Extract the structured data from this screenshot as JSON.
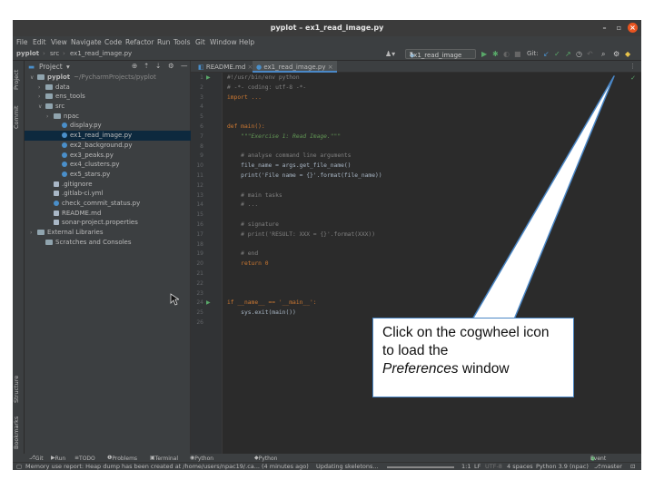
{
  "window": {
    "title": "pyplot – ex1_read_image.py"
  },
  "menu": [
    "File",
    "Edit",
    "View",
    "Navigate",
    "Code",
    "Refactor",
    "Run",
    "Tools",
    "Git",
    "Window",
    "Help"
  ],
  "breadcrumb": {
    "project": "pyplot",
    "sep1": "›",
    "folder": "src",
    "sep2": "›",
    "file": "ex1_read_image.py"
  },
  "run_config": "ex1_read_image",
  "git_label": "Git:",
  "side_left": {
    "project": "Project",
    "commit": "Commit",
    "structure": "Structure",
    "bookmarks": "Bookmarks"
  },
  "project_panel": {
    "title": "Project"
  },
  "tree": [
    {
      "arrow": "∨",
      "label": "pyplot",
      "extra": "~/PycharmProjects/pyplot",
      "type": "folder",
      "indent": 0
    },
    {
      "arrow": "›",
      "label": "data",
      "extra": "",
      "type": "folder",
      "indent": 1
    },
    {
      "arrow": "›",
      "label": "ens_tools",
      "extra": "",
      "type": "folder",
      "indent": 1
    },
    {
      "arrow": "∨",
      "label": "src",
      "extra": "",
      "type": "folder",
      "indent": 1
    },
    {
      "arrow": "›",
      "label": "npac",
      "extra": "",
      "type": "folder",
      "indent": 2
    },
    {
      "arrow": "",
      "label": "display.py",
      "extra": "",
      "type": "py",
      "indent": 3
    },
    {
      "arrow": "",
      "label": "ex1_read_image.py",
      "extra": "",
      "type": "py",
      "indent": 3,
      "selected": true
    },
    {
      "arrow": "",
      "label": "ex2_background.py",
      "extra": "",
      "type": "py",
      "indent": 3
    },
    {
      "arrow": "",
      "label": "ex3_peaks.py",
      "extra": "",
      "type": "py",
      "indent": 3
    },
    {
      "arrow": "",
      "label": "ex4_clusters.py",
      "extra": "",
      "type": "py",
      "indent": 3
    },
    {
      "arrow": "",
      "label": "ex5_stars.py",
      "extra": "",
      "type": "py",
      "indent": 3
    },
    {
      "arrow": "",
      "label": ".gitignore",
      "extra": "",
      "type": "file",
      "indent": 2
    },
    {
      "arrow": "",
      "label": ".gitlab-ci.yml",
      "extra": "",
      "type": "file",
      "indent": 2
    },
    {
      "arrow": "",
      "label": "check_commit_status.py",
      "extra": "",
      "type": "py",
      "indent": 2
    },
    {
      "arrow": "",
      "label": "README.md",
      "extra": "",
      "type": "file",
      "indent": 2
    },
    {
      "arrow": "",
      "label": "sonar-project.properties",
      "extra": "",
      "type": "file",
      "indent": 2
    },
    {
      "arrow": "›",
      "label": "External Libraries",
      "extra": "",
      "type": "folder",
      "indent": 0
    },
    {
      "arrow": "",
      "label": "Scratches and Consoles",
      "extra": "",
      "type": "folder",
      "indent": 1
    }
  ],
  "tabs": [
    {
      "label": "README.md"
    },
    {
      "label": "ex1_read_image.py"
    }
  ],
  "code_lines": [
    "#!/usr/bin/env python",
    "# -*- coding: utf-8 -*-",
    "import ...",
    "",
    "",
    "def main():",
    "    \"\"\"Exercise 1: Read Image.\"\"\"",
    "",
    "    # analyse command line arguments",
    "    file_name = args.get_file_name()",
    "    print('File name = {}'.format(file_name))",
    "",
    "    # main tasks",
    "    # ...",
    "",
    "    # signature",
    "    # print('RESULT: XXX = {}'.format(XXX))",
    "",
    "    # end",
    "    return 0",
    "",
    "",
    "",
    "if __name__ == '__main__':",
    "    sys.exit(main())",
    ""
  ],
  "bottom_tools": [
    "Git",
    "Run",
    "TODO",
    "Problems",
    "Terminal",
    "Python Packages",
    "Python Console"
  ],
  "event_log": "Event Log",
  "status": {
    "message": "Memory use report: Heap dump has been created at /home/users/npac19/.ca... (4 minutes ago)",
    "task": "Updating skeletons...",
    "position": "1:1",
    "line_sep": "LF",
    "encoding": "UTF-8",
    "indent": "4 spaces",
    "interpreter": "Python 3.9 (npac)",
    "branch": "master"
  },
  "callout": {
    "line1": "Click on the cogwheel icon to load the",
    "emph": "Preferences",
    "line2": "window"
  }
}
